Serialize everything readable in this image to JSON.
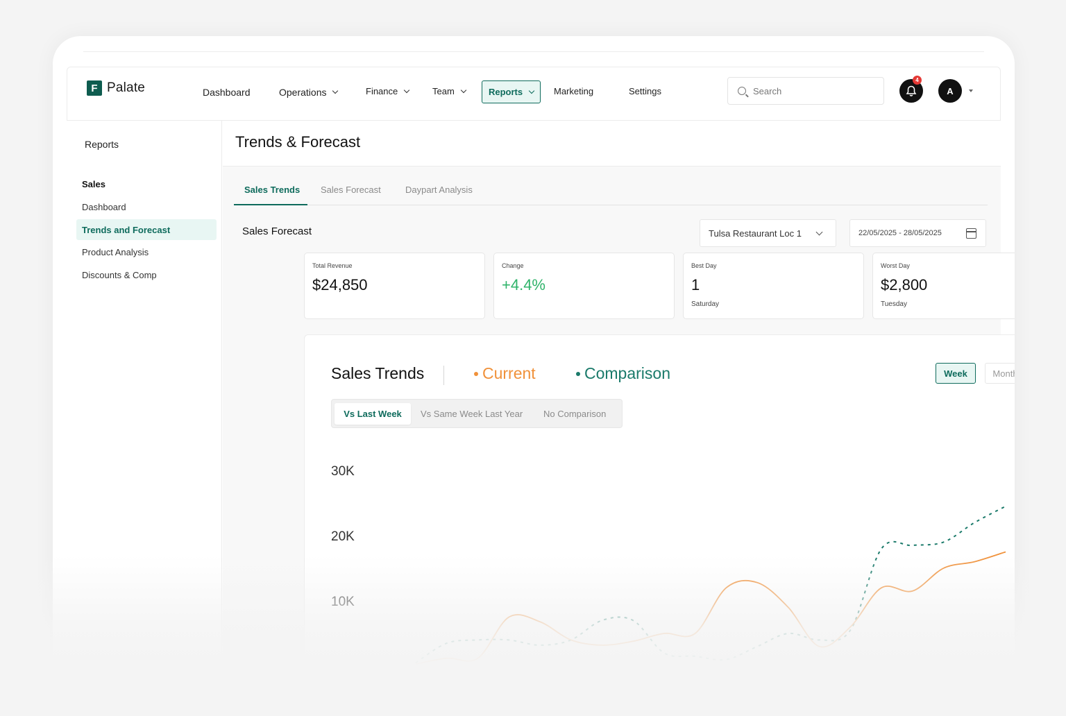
{
  "app": {
    "logo_letter": "F",
    "name": "Palate"
  },
  "nav": {
    "items": [
      {
        "label": "Dashboard",
        "dropdown": false
      },
      {
        "label": "Operations",
        "dropdown": true
      },
      {
        "label": "Finance",
        "dropdown": true
      },
      {
        "label": "Team",
        "dropdown": true
      },
      {
        "label": "Reports",
        "dropdown": true,
        "active": true
      },
      {
        "label": "Marketing",
        "dropdown": false
      },
      {
        "label": "Settings",
        "dropdown": false
      }
    ],
    "search_placeholder": "Search",
    "notification_count": "4",
    "avatar_initial": "A"
  },
  "sidebar": {
    "title": "Reports",
    "section": "Sales",
    "items": [
      {
        "label": "Dashboard",
        "active": false
      },
      {
        "label": "Trends and Forecast",
        "active": true
      },
      {
        "label": "Product Analysis",
        "active": false
      },
      {
        "label": "Discounts & Comp",
        "active": false
      }
    ]
  },
  "page": {
    "title": "Trends & Forecast",
    "tabs": [
      "Sales Trends",
      "Sales Forecast",
      "Daypart Analysis"
    ],
    "active_tab": "Sales Trends"
  },
  "forecast": {
    "title": "Sales Forecast",
    "location": "Tulsa Restaurant Loc 1",
    "date_range": "22/05/2025 - 28/05/2025",
    "stats": [
      {
        "label": "Total Revenue",
        "value": "$24,850",
        "sub": ""
      },
      {
        "label": "Change",
        "value": "+4.4%",
        "sub": ""
      },
      {
        "label": "Best Day",
        "value": "1",
        "sub": "Saturday"
      },
      {
        "label": "Worst Day",
        "value": "$2,800",
        "sub": "Tuesday"
      }
    ]
  },
  "trends": {
    "title": "Sales Trends",
    "legend_current": "Current",
    "legend_comparison": "Comparison",
    "range_week": "Week",
    "range_month": "Month",
    "comparison_options": [
      "Vs Last Week",
      "Vs Same Week Last Year",
      "No Comparison"
    ],
    "active_comparison": "Vs Last Week"
  },
  "colors": {
    "accent": "#0e6b5c",
    "accent_bg": "#e8f6f3",
    "current_line": "#f0913a",
    "comparison_line": "#1a7a6a",
    "positive": "#2fb36a"
  },
  "chart_data": {
    "type": "line",
    "y_ticks": [
      "30K",
      "20K",
      "10K"
    ],
    "ylim": [
      0,
      30000
    ],
    "x_count": 19,
    "series": [
      {
        "name": "Current",
        "color": "#f0913a",
        "style": "solid",
        "values": [
          300,
          1200,
          1200,
          7500,
          6800,
          4000,
          3200,
          3800,
          5000,
          5000,
          12000,
          12800,
          9000,
          3000,
          6000,
          12000,
          11500,
          15000,
          16000,
          17500
        ]
      },
      {
        "name": "Comparison",
        "color": "#1a7a6a",
        "style": "dashed",
        "values": [
          500,
          3500,
          4000,
          4000,
          3200,
          4000,
          7000,
          7000,
          2000,
          1500,
          1000,
          3000,
          5000,
          4000,
          5500,
          18000,
          18500,
          19000,
          22000,
          24500
        ]
      }
    ]
  }
}
